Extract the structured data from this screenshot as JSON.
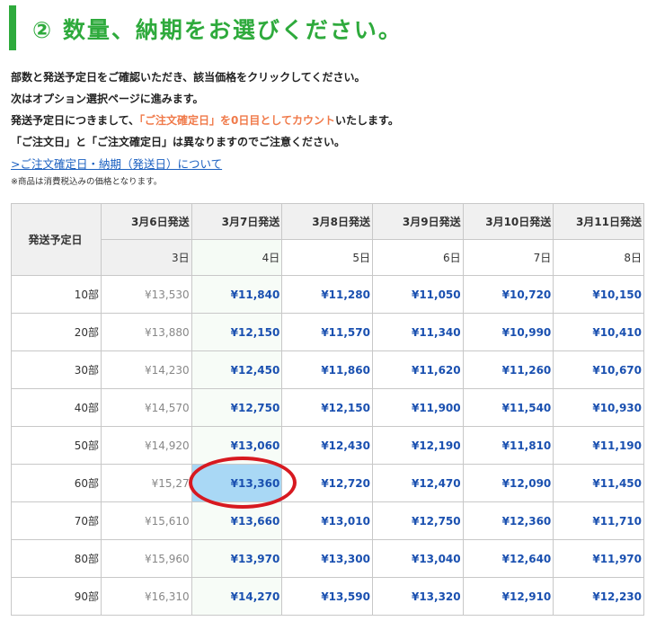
{
  "heading": {
    "title": "② 数量、納期をお選びください。"
  },
  "notes": {
    "line1": "部数と発送予定日をご確認いただき、該当価格をクリックしてください。",
    "line2": "次はオプション選択ページに進みます。",
    "line3_pre": "発送予定日につきまして、",
    "line3_highlight": "「ご注文確定日」を0日目としてカウント",
    "line3_post": "いたします。",
    "line4": "「ご注文日」と「ご注文確定日」は異なりますのでご注意ください。"
  },
  "link": {
    "label": ">ご注文確定日・納期（発送日）について"
  },
  "small_note": "※商品は消費税込みの価格となります。",
  "colors": {
    "accent": "#2eaa3c",
    "price": "#1a50b0",
    "highlight": "#f07a4a",
    "selected": "#a9d8f5",
    "circle": "#d71920"
  },
  "table": {
    "row_header": "発送予定日",
    "columns": [
      {
        "date": "3月6日発送",
        "days": "3日"
      },
      {
        "date": "3月7日発送",
        "days": "4日"
      },
      {
        "date": "3月8日発送",
        "days": "5日"
      },
      {
        "date": "3月9日発送",
        "days": "6日"
      },
      {
        "date": "3月10日発送",
        "days": "7日"
      },
      {
        "date": "3月11日発送",
        "days": "8日"
      }
    ],
    "rows": [
      {
        "qty": "10部",
        "prices": [
          "¥13,530",
          "¥11,840",
          "¥11,280",
          "¥11,050",
          "¥10,720",
          "¥10,150"
        ]
      },
      {
        "qty": "20部",
        "prices": [
          "¥13,880",
          "¥12,150",
          "¥11,570",
          "¥11,340",
          "¥10,990",
          "¥10,410"
        ]
      },
      {
        "qty": "30部",
        "prices": [
          "¥14,230",
          "¥12,450",
          "¥11,860",
          "¥11,620",
          "¥11,260",
          "¥10,670"
        ]
      },
      {
        "qty": "40部",
        "prices": [
          "¥14,570",
          "¥12,750",
          "¥12,150",
          "¥11,900",
          "¥11,540",
          "¥10,930"
        ]
      },
      {
        "qty": "50部",
        "prices": [
          "¥14,920",
          "¥13,060",
          "¥12,430",
          "¥12,190",
          "¥11,810",
          "¥11,190"
        ]
      },
      {
        "qty": "60部",
        "prices": [
          "¥15,27",
          "¥13,360",
          "¥12,720",
          "¥12,470",
          "¥12,090",
          "¥11,450"
        ]
      },
      {
        "qty": "70部",
        "prices": [
          "¥15,610",
          "¥13,660",
          "¥13,010",
          "¥12,750",
          "¥12,360",
          "¥11,710"
        ]
      },
      {
        "qty": "80部",
        "prices": [
          "¥15,960",
          "¥13,970",
          "¥13,300",
          "¥13,040",
          "¥12,640",
          "¥11,970"
        ]
      },
      {
        "qty": "90部",
        "prices": [
          "¥16,310",
          "¥14,270",
          "¥13,590",
          "¥13,320",
          "¥12,910",
          "¥12,230"
        ]
      }
    ],
    "selected": {
      "row": 5,
      "col": 1
    }
  }
}
